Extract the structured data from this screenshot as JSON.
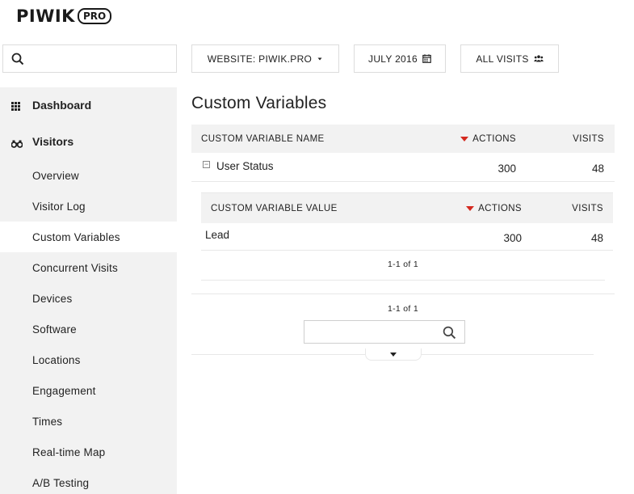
{
  "logo": {
    "main": "PIWIK",
    "badge": "PRO"
  },
  "search": {
    "value": "",
    "placeholder": ""
  },
  "top_selectors": {
    "website": {
      "label": "WEBSITE: PIWIK.PRO",
      "icon": "caret-down-icon"
    },
    "date": {
      "label": "JULY 2016",
      "icon": "calendar-icon"
    },
    "segment": {
      "label": "ALL VISITS",
      "icon": "users-icon"
    }
  },
  "sidebar": {
    "dashboard": {
      "label": "Dashboard",
      "icon": "grid-icon"
    },
    "visitors": {
      "label": "Visitors",
      "icon": "binoculars-icon"
    },
    "items": [
      {
        "label": "Overview"
      },
      {
        "label": "Visitor Log"
      },
      {
        "label": "Custom Variables",
        "active": true
      },
      {
        "label": "Concurrent Visits"
      },
      {
        "label": "Devices"
      },
      {
        "label": "Software"
      },
      {
        "label": "Locations"
      },
      {
        "label": "Engagement"
      },
      {
        "label": "Times"
      },
      {
        "label": "Real-time Map"
      },
      {
        "label": "A/B Testing"
      }
    ]
  },
  "main": {
    "title": "Custom Variables",
    "table": {
      "headers": {
        "name": "CUSTOM VARIABLE NAME",
        "actions": "ACTIONS",
        "visits": "VISITS"
      },
      "rows": [
        {
          "name": "User Status",
          "actions": "300",
          "visits": "48"
        }
      ],
      "pager": "1-1 of 1",
      "search": {
        "value": "",
        "placeholder": ""
      }
    },
    "subtable": {
      "headers": {
        "name": "CUSTOM VARIABLE VALUE",
        "actions": "ACTIONS",
        "visits": "VISITS"
      },
      "rows": [
        {
          "name": "Lead",
          "actions": "300",
          "visits": "48"
        }
      ],
      "pager": "1-1 of 1"
    }
  },
  "colors": {
    "sort_arrow": "#d4291f",
    "sidebar_bg": "#f2f2f2",
    "header_bg": "#f2f2f2"
  }
}
